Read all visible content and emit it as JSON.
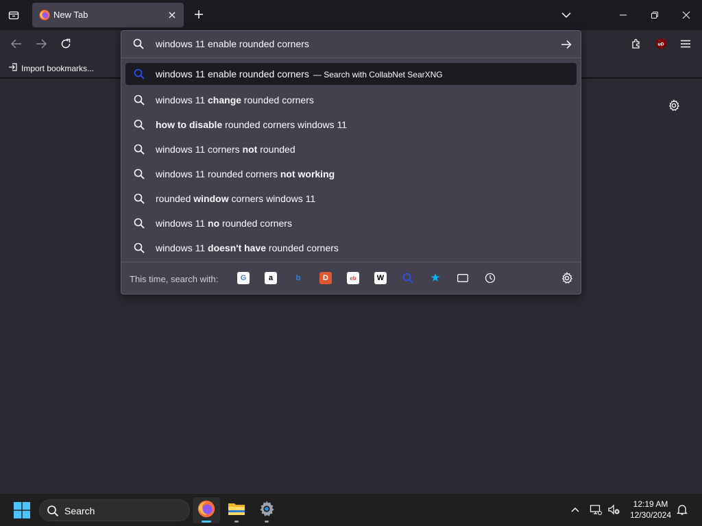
{
  "tab": {
    "title": "New Tab"
  },
  "bookmarks": {
    "import_label": "Import bookmarks..."
  },
  "urlbar": {
    "value": "windows 11 enable rounded corners",
    "results": [
      {
        "parts": [
          {
            "t": "windows 11 enable rounded corners",
            "b": false
          }
        ],
        "action": "— Search with CollabNet SearXNG"
      },
      {
        "parts": [
          {
            "t": "windows 11 ",
            "b": false
          },
          {
            "t": "change",
            "b": true
          },
          {
            "t": " rounded corners",
            "b": false
          }
        ]
      },
      {
        "parts": [
          {
            "t": "how to disable",
            "b": true
          },
          {
            "t": " rounded corners windows 11",
            "b": false
          }
        ]
      },
      {
        "parts": [
          {
            "t": "windows 11 corners ",
            "b": false
          },
          {
            "t": "not",
            "b": true
          },
          {
            "t": " rounded",
            "b": false
          }
        ]
      },
      {
        "parts": [
          {
            "t": "windows 11 rounded corners ",
            "b": false
          },
          {
            "t": "not working",
            "b": true
          }
        ]
      },
      {
        "parts": [
          {
            "t": "rounded ",
            "b": false
          },
          {
            "t": "window",
            "b": true
          },
          {
            "t": " corners windows 11",
            "b": false
          }
        ]
      },
      {
        "parts": [
          {
            "t": "windows 11 ",
            "b": false
          },
          {
            "t": "no",
            "b": true
          },
          {
            "t": " rounded corners",
            "b": false
          }
        ]
      },
      {
        "parts": [
          {
            "t": "windows 11 ",
            "b": false
          },
          {
            "t": "doesn't have",
            "b": true
          },
          {
            "t": " rounded corners",
            "b": false
          }
        ]
      }
    ],
    "oneoff_label": "This time, search with:",
    "engines": [
      {
        "name": "google-icon",
        "glyph": "G",
        "bg": "#ffffff",
        "fg": "#4285f4"
      },
      {
        "name": "amazon-icon",
        "glyph": "a",
        "bg": "#ffffff",
        "fg": "#000000"
      },
      {
        "name": "bing-icon",
        "glyph": "b",
        "bg": "transparent",
        "fg": "#2f80ed"
      },
      {
        "name": "duckduckgo-icon",
        "glyph": "D",
        "bg": "#de5833",
        "fg": "#ffffff"
      },
      {
        "name": "ebay-icon",
        "glyph": "eb",
        "bg": "#ffffff",
        "fg": "#e53238"
      },
      {
        "name": "wikipedia-icon",
        "glyph": "W",
        "bg": "#ffffff",
        "fg": "#000000"
      },
      {
        "name": "searxng-icon",
        "glyph": "",
        "bg": "transparent",
        "fg": "#3050ff"
      },
      {
        "name": "bookmarks-star-icon",
        "glyph": "★",
        "bg": "transparent",
        "fg": "#00b3f4"
      },
      {
        "name": "tabs-icon",
        "glyph": "",
        "bg": "transparent",
        "fg": "#fbfbfe"
      },
      {
        "name": "history-icon",
        "glyph": "",
        "bg": "transparent",
        "fg": "#fbfbfe"
      }
    ]
  },
  "taskbar": {
    "search_label": "Search",
    "time": "12:19 AM",
    "date": "12/30/2024"
  },
  "colors": {
    "accent": "#3050ff",
    "taskbar_indicator": "#4cc2ff"
  }
}
